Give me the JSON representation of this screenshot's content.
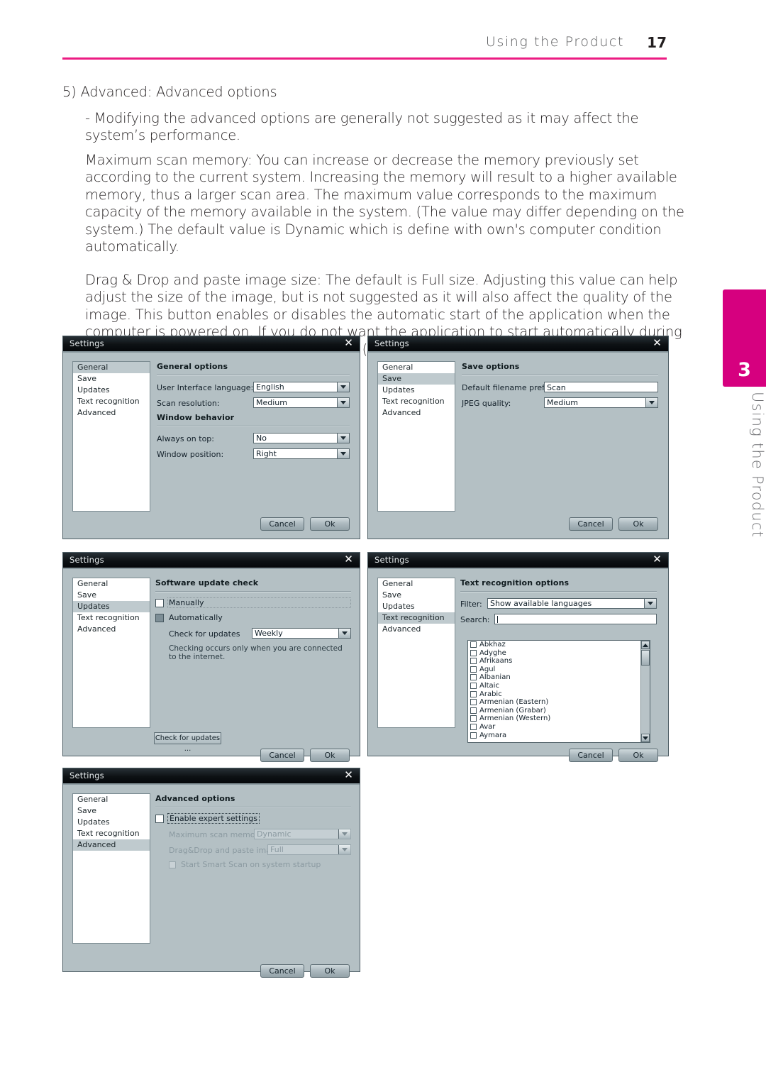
{
  "header": {
    "section_title": "Using the Product",
    "page_number": "17",
    "rule_color": "#ec1c83"
  },
  "side_tab": {
    "number": "3",
    "label": "Using the Product",
    "color": "#d6007f"
  },
  "body": {
    "heading": "5) Advanced: Advanced options",
    "bullet": "- Modifying the advanced options are generally not suggested as it may affect the system’s performance.",
    "paragraph1": "Maximum scan memory: You can increase or decrease the memory previously set according to the current system. Increasing the memory will result to a higher available memory, thus a larger scan area. The maximum value corresponds to the maximum capacity of the memory available in the system. (The value may differ depending on the system.) The default value is Dynamic which is define with own's computer condition automatically.",
    "paragraph2": "Drag & Drop and paste image size: The default is Full size. Adjusting this value can help adjust the size of the image, but is not suggested as it will also affect the quality of the image. This button enables or disables the automatic start of the application when the computer is powered on. If you do not want the application to start automatically during the system startup, clear the check box.  (Automatic start is suggested to ensure automatic update.)"
  },
  "dialog_common": {
    "title": "Settings",
    "close_icon": "close-icon",
    "nav_items": [
      "General",
      "Save",
      "Updates",
      "Text recognition",
      "Advanced"
    ],
    "cancel_label": "Cancel",
    "ok_label": "Ok"
  },
  "dialog_general": {
    "selected_nav": "General",
    "pane_title": "General options",
    "fields": [
      {
        "label": "User Interface language:",
        "value": "English",
        "control": "combo"
      },
      {
        "label": "Scan resolution:",
        "value": "Medium",
        "control": "combo"
      }
    ],
    "subsection_title": "Window behavior",
    "fields2": [
      {
        "label": "Always on top:",
        "value": "No",
        "control": "combo"
      },
      {
        "label": "Window position:",
        "value": "Right",
        "control": "combo"
      }
    ]
  },
  "dialog_save": {
    "selected_nav": "Save",
    "pane_title": "Save options",
    "fields": [
      {
        "label": "Default filename prefix:",
        "value": "Scan",
        "control": "text"
      },
      {
        "label": "JPEG quality:",
        "value": "Medium",
        "control": "combo"
      }
    ]
  },
  "dialog_updates": {
    "selected_nav": "Updates",
    "pane_title": "Software update check",
    "manual_label": "Manually",
    "manual_checked": false,
    "auto_label": "Automatically",
    "auto_checked": true,
    "check_label": "Check for updates",
    "check_value": "Weekly",
    "note": "Checking occurs only when you are connected to the internet.",
    "check_button_label": "Check for updates ..."
  },
  "dialog_text_recognition": {
    "selected_nav": "Text recognition",
    "pane_title": "Text recognition options",
    "filter_label": "Filter:",
    "filter_value": "Show available languages",
    "search_label": "Search:",
    "search_value": "",
    "languages": [
      "Abkhaz",
      "Adyghe",
      "Afrikaans",
      "Agul",
      "Albanian",
      "Altaic",
      "Arabic",
      "Armenian (Eastern)",
      "Armenian (Grabar)",
      "Armenian (Western)",
      "Avar",
      "Aymara"
    ]
  },
  "dialog_advanced": {
    "selected_nav": "Advanced",
    "pane_title": "Advanced options",
    "expert_label": "Enable expert settings",
    "expert_checked": false,
    "fields": [
      {
        "label": "Maximum scan memory:",
        "value": "Dynamic"
      },
      {
        "label": "Drag&Drop and paste image size:",
        "value": "Full"
      }
    ],
    "startup_label": "Start Smart Scan on system startup",
    "startup_checked": false
  }
}
